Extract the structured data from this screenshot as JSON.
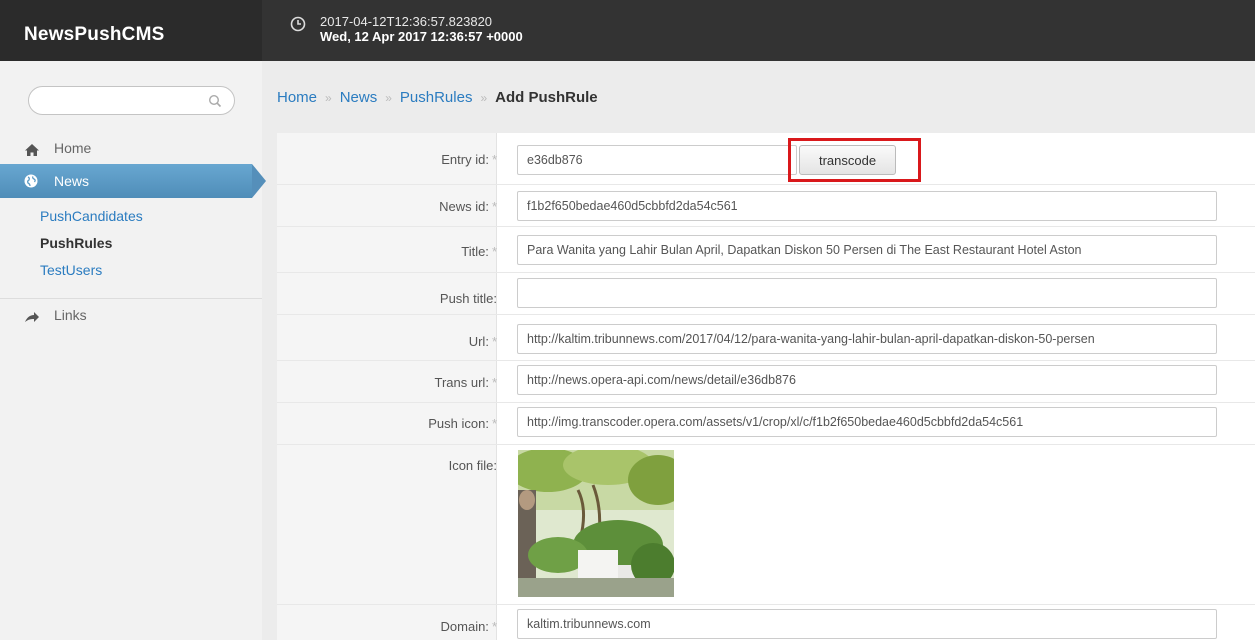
{
  "app": {
    "title": "NewsPushCMS"
  },
  "header": {
    "timestamp_iso": "2017-04-12T12:36:57.823820",
    "timestamp_human": "Wed, 12 Apr 2017 12:36:57 +0000",
    "clock_icon": "clock-icon"
  },
  "sidebar": {
    "search": {
      "placeholder": "",
      "icon": "search-icon"
    },
    "items": [
      {
        "label": "Home",
        "icon": "home-icon"
      },
      {
        "label": "News",
        "icon": "globe-icon",
        "active": true
      },
      {
        "label": "Links",
        "icon": "share-arrow-icon"
      }
    ],
    "subitems": [
      {
        "label": "PushCandidates"
      },
      {
        "label": "PushRules",
        "active": true
      },
      {
        "label": "TestUsers"
      }
    ]
  },
  "breadcrumb": {
    "items": [
      "Home",
      "News",
      "PushRules"
    ],
    "separator": "»",
    "current": "Add PushRule"
  },
  "form": {
    "required_mark": "*",
    "entry_id": {
      "label": "Entry id:",
      "value": "e36db876"
    },
    "transcode_button": "transcode",
    "news_id": {
      "label": "News id:",
      "value": "f1b2f650bedae460d5cbbfd2da54c561"
    },
    "title": {
      "label": "Title:",
      "value": "Para Wanita yang Lahir Bulan April, Dapatkan Diskon 50 Persen di The East Restaurant Hotel Aston"
    },
    "push_title": {
      "label": "Push title:",
      "value": ""
    },
    "url": {
      "label": "Url:",
      "value": "http://kaltim.tribunnews.com/2017/04/12/para-wanita-yang-lahir-bulan-april-dapatkan-diskon-50-persen"
    },
    "trans_url": {
      "label": "Trans url:",
      "value": "http://news.opera-api.com/news/detail/e36db876"
    },
    "push_icon": {
      "label": "Push icon:",
      "value": "http://img.transcoder.opera.com/assets/v1/crop/xl/c/f1b2f650bedae460d5cbbfd2da54c561"
    },
    "icon_file": {
      "label": "Icon file:"
    },
    "domain": {
      "label": "Domain:",
      "value": "kaltim.tribunnews.com"
    }
  },
  "colors": {
    "topbar": "#333333",
    "nav_active": "#5b9ac4",
    "link": "#2b7cc0",
    "highlight": "#d9181b"
  }
}
